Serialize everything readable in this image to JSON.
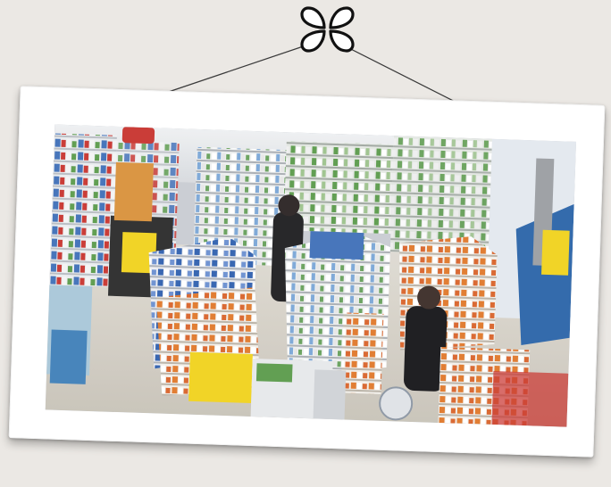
{
  "scene": {
    "hanger_icon": "four-petal-flower-icon",
    "photo_subject": "pharmacy-store-interior",
    "colors": {
      "background": "#ebe8e4",
      "frame": "#ffffff",
      "string": "#3a3a3a",
      "icon_stroke": "#111111",
      "floor": "#d9d6cf",
      "shelf_white": "#f2f2f2",
      "product_orange": "#e0782a",
      "product_yellow": "#f1d21c",
      "product_blue": "#3f6fb8",
      "product_red": "#c8332e",
      "product_green": "#5a9a4a",
      "window_blue": "#2a64a8"
    }
  }
}
